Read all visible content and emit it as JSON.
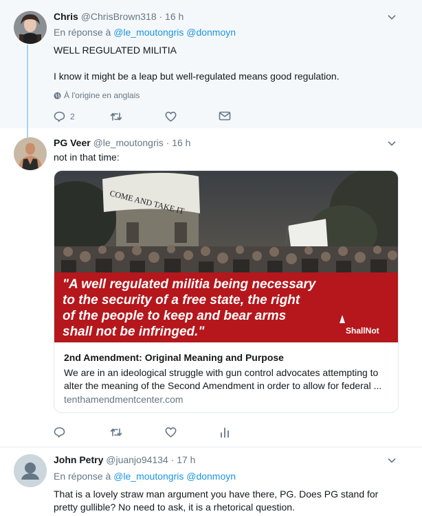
{
  "tweet1": {
    "name": "Chris",
    "handle": "@ChrisBrown318",
    "time": "· 16 h",
    "reply_prefix": "En réponse à",
    "reply_user1": "@le_moutongris",
    "reply_user2": "@donmoyn",
    "line1": "WELL REGULATED MILITIA",
    "line2": "I know it might be a leap but well-regulated means good regulation.",
    "translation_label": "À l'origine en anglais",
    "reply_count": "2",
    "icons": [
      "reply-icon",
      "retweet-icon",
      "like-icon",
      "dm-icon",
      "globe-icon",
      "chevron-down-icon"
    ]
  },
  "tweet2": {
    "name": "PG Veer",
    "handle": "@le_moutongris",
    "time": "· 16 h",
    "text": "not in that time:",
    "card": {
      "image_quote": "\"A well regulated militia being necessary to the security of a free state, the right of the people to keep and bear arms shall not be infringed.\"",
      "image_quote_lines": [
        "\"A well regulated militia being necessary",
        "to the security of a free state, the right",
        "of the people to keep and bear arms",
        "shall not be infringed.\""
      ],
      "flag_text": "COME AND TAKE IT",
      "logo_text": "ShallNot",
      "title": "2nd Amendment: Original Meaning and Purpose",
      "description": "We are in an ideological struggle with gun control advocates attempting to alter the meaning of the Second Amendment in order to allow for federal ...",
      "domain": "tenthamendmentcenter.com"
    },
    "icons": [
      "reply-icon",
      "retweet-icon",
      "like-icon",
      "analytics-icon",
      "chevron-down-icon"
    ]
  },
  "tweet3": {
    "name": "John Petry",
    "handle": "@juanjo94134",
    "time": "· 17 h",
    "reply_prefix": "En réponse à",
    "reply_user1": "@le_moutongris",
    "reply_user2": "@donmoyn",
    "text": "That is a lovely straw man argument you have there, PG.  Does PG stand for pretty gullible?  No need to ask, it is a rhetorical question.",
    "icons": [
      "default-avatar-icon",
      "chevron-down-icon"
    ]
  },
  "colors": {
    "link": "#1b95e0",
    "muted": "#657786",
    "thread_line": "#a7d2f3",
    "highlight_bg": "#f5f8fa",
    "banner_red": "#b5171c"
  }
}
